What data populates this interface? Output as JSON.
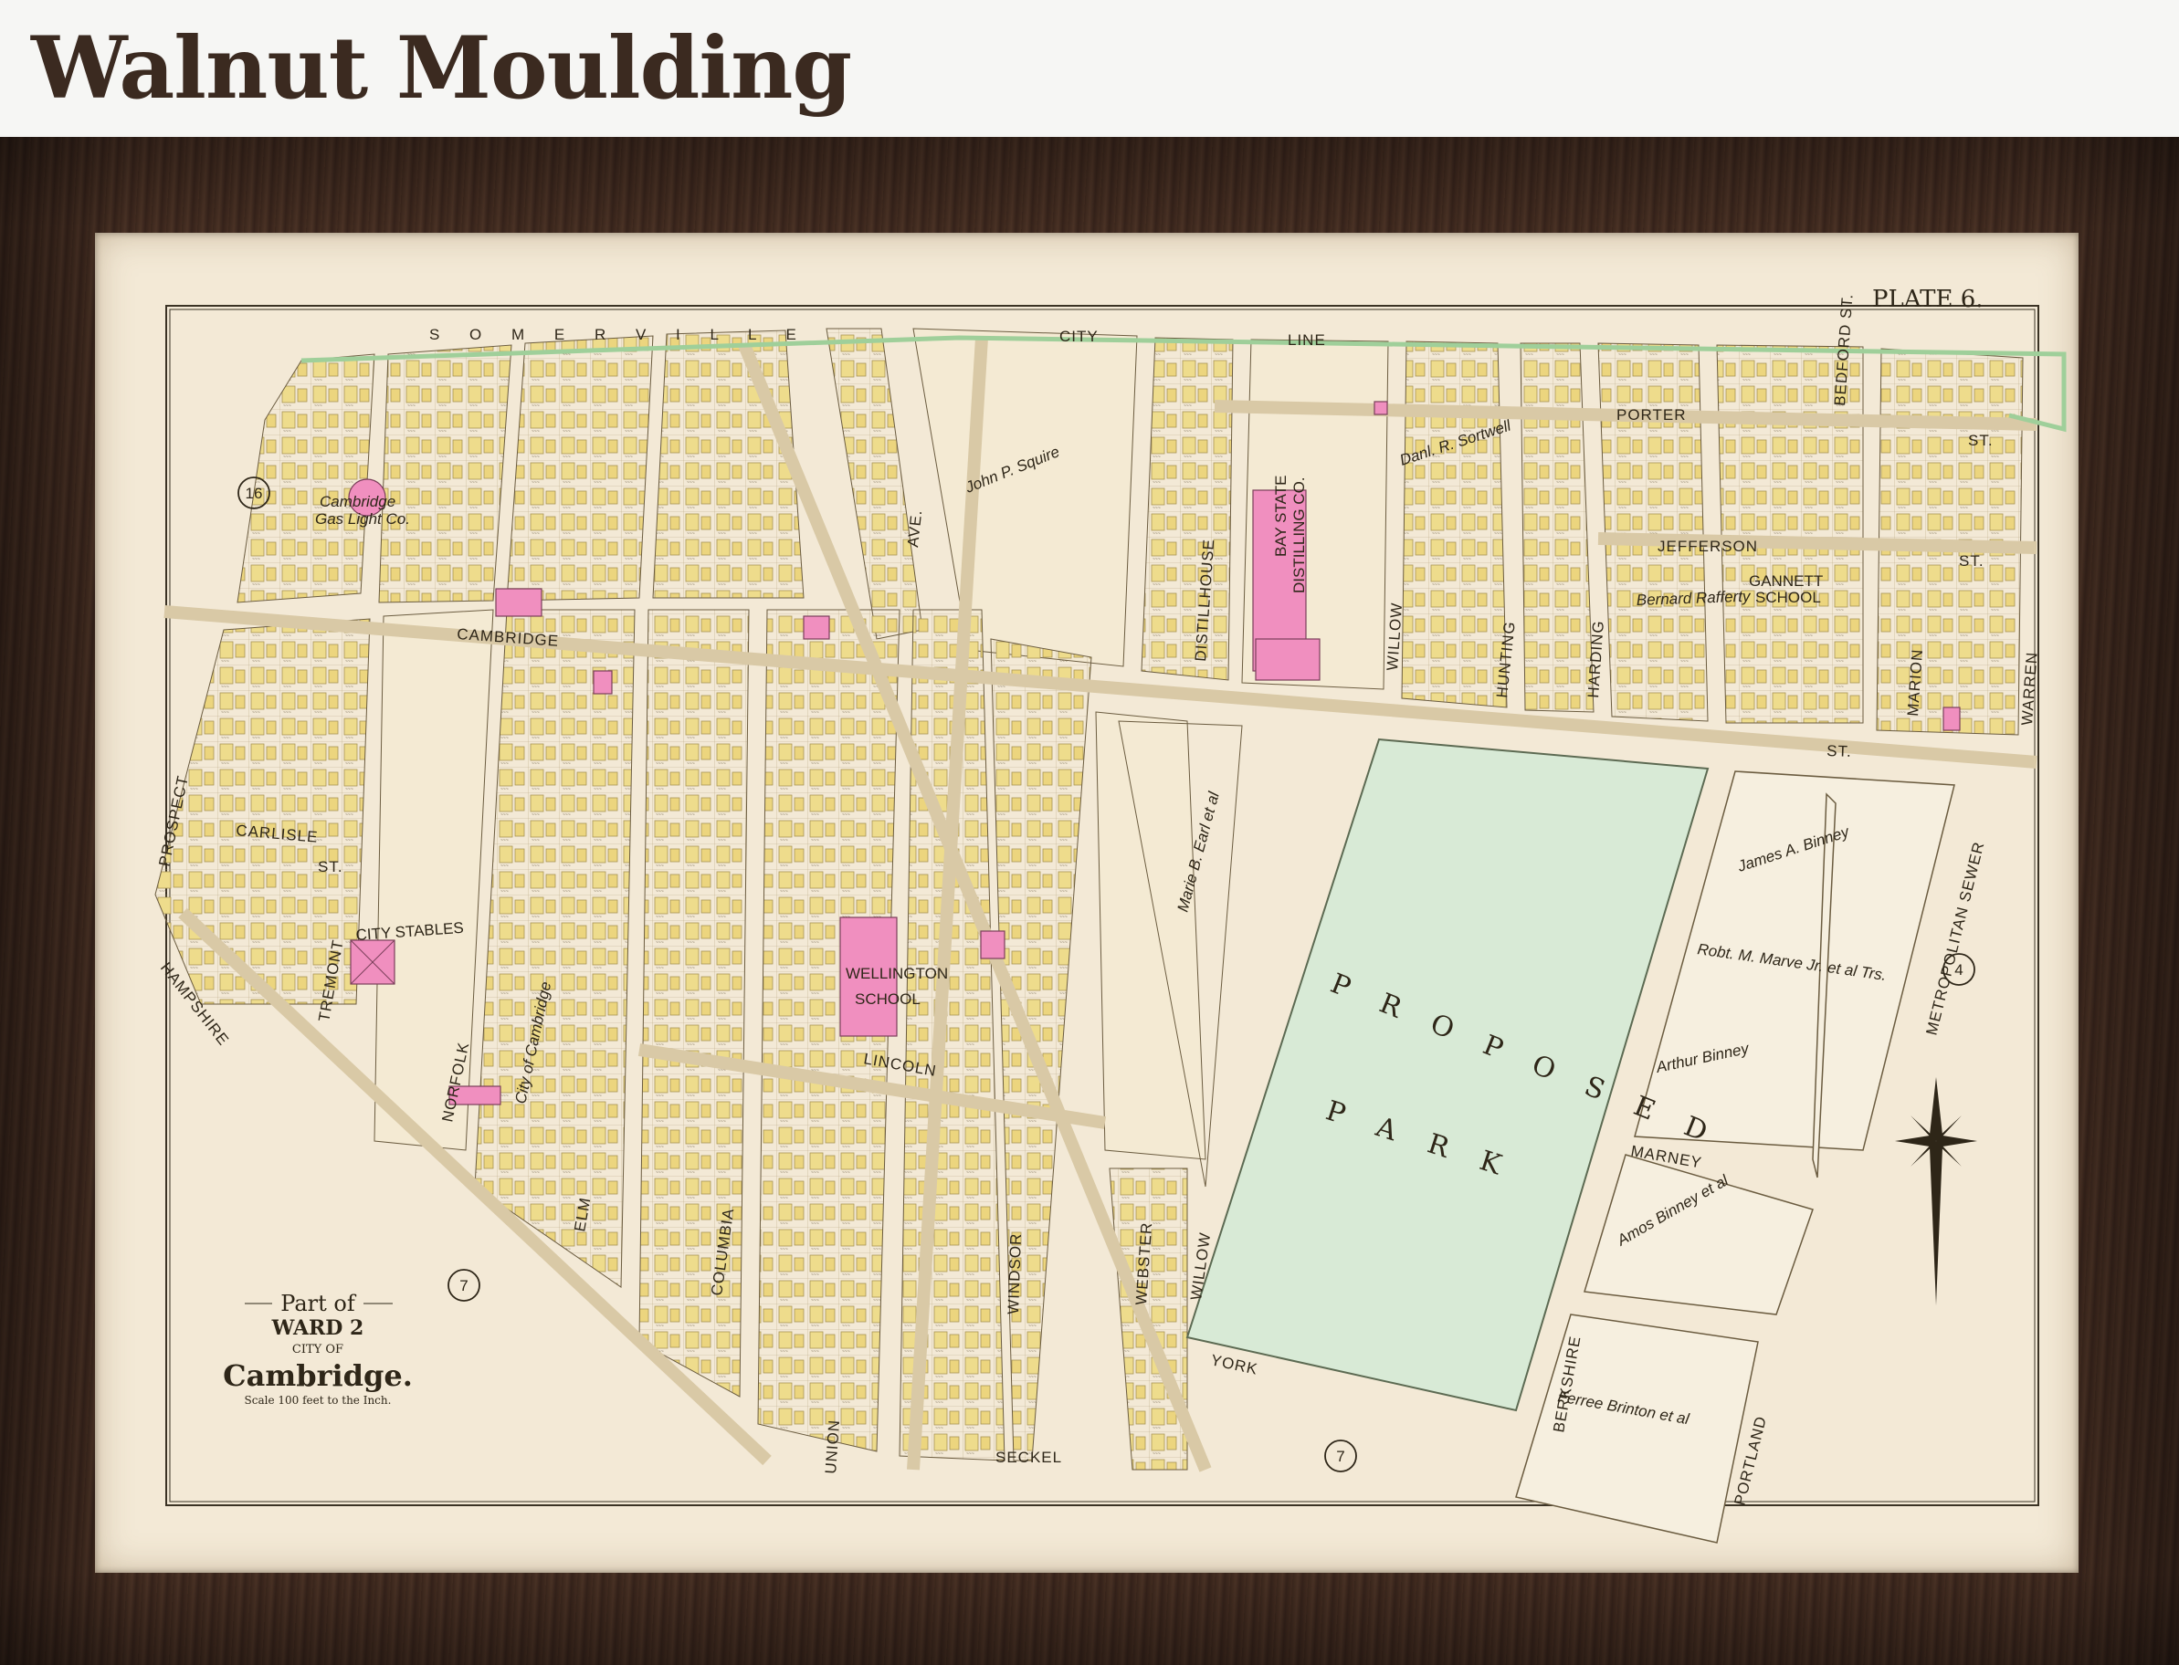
{
  "header": {
    "title": "Walnut Moulding"
  },
  "map": {
    "plate": "PLATE 6.",
    "title": {
      "part_of": "Part of",
      "ward": "WARD 2",
      "city_of": "CITY OF",
      "city": "Cambridge.",
      "scale": "Scale 100 feet to the Inch."
    },
    "somerville": "S O M E R V I L L E",
    "city_line": [
      "CITY",
      "LINE"
    ],
    "ward_numbers": [
      "16",
      "7",
      "7",
      "4"
    ],
    "park": [
      "P R O P O S E D",
      "P A R K"
    ],
    "streets": {
      "cambridge": "CAMBRIDGE",
      "porter": "PORTER",
      "jefferson": "JEFFERSON",
      "st": "ST.",
      "carlisle": "CARLISLE",
      "prospect": "PROSPECT",
      "hampshire": "HAMPSHIRE",
      "tremont": "TREMONT",
      "norfolk": "NORFOLK",
      "elm": "ELM",
      "columbia": "COLUMBIA",
      "lincoln": "LINCOLN",
      "union": "UNION",
      "windsor": "WINDSOR",
      "webster": "WEBSTER",
      "willow": "WILLOW",
      "york": "YORK",
      "seckel": "SECKEL",
      "berkshire": "BERKSHIRE",
      "portland": "PORTLAND",
      "marney": "MARNEY",
      "distillhouse": "DISTILLHOUSE",
      "hunting": "HUNTING",
      "harding": "HARDING",
      "marion": "MARION",
      "warren": "WARREN",
      "ave": "AVE.",
      "metropolitan_sewer": "METROPOLITAN SEWER",
      "bedford": "BEDFORD ST."
    },
    "buildings": {
      "bay_state": [
        "BAY STATE",
        "DISTILLING CO."
      ],
      "wellington": [
        "WELLINGTON",
        "SCHOOL"
      ],
      "gannett": [
        "GANNETT",
        "SCHOOL"
      ],
      "city_stables": "CITY STABLES",
      "gas_light": [
        "Cambridge",
        "Gas Light Co."
      ]
    },
    "owners": {
      "james_binney": "James A. Binney",
      "robt_marve": "Robt. M. Marve Jr. et al Trs.",
      "arthur_binney": "Arthur Binney",
      "amos_binney": "Amos Binney et al",
      "ferree": "Ferree Brinton et al",
      "marie_earl": "Marie B. Earl et al",
      "city_of_cambridge": "City of Cambridge",
      "bernard_rafferty": "Bernard Rafferty",
      "daniel_sortwell": "Danl. R. Sortwell",
      "john_squire": "John P. Squire"
    }
  },
  "colors": {
    "paper": "#f3e9d6",
    "building_yellow": "#eedc8c",
    "building_pink": "#f08fbf",
    "park_green": "#d8ead6",
    "frame_walnut": "#3a261c"
  }
}
